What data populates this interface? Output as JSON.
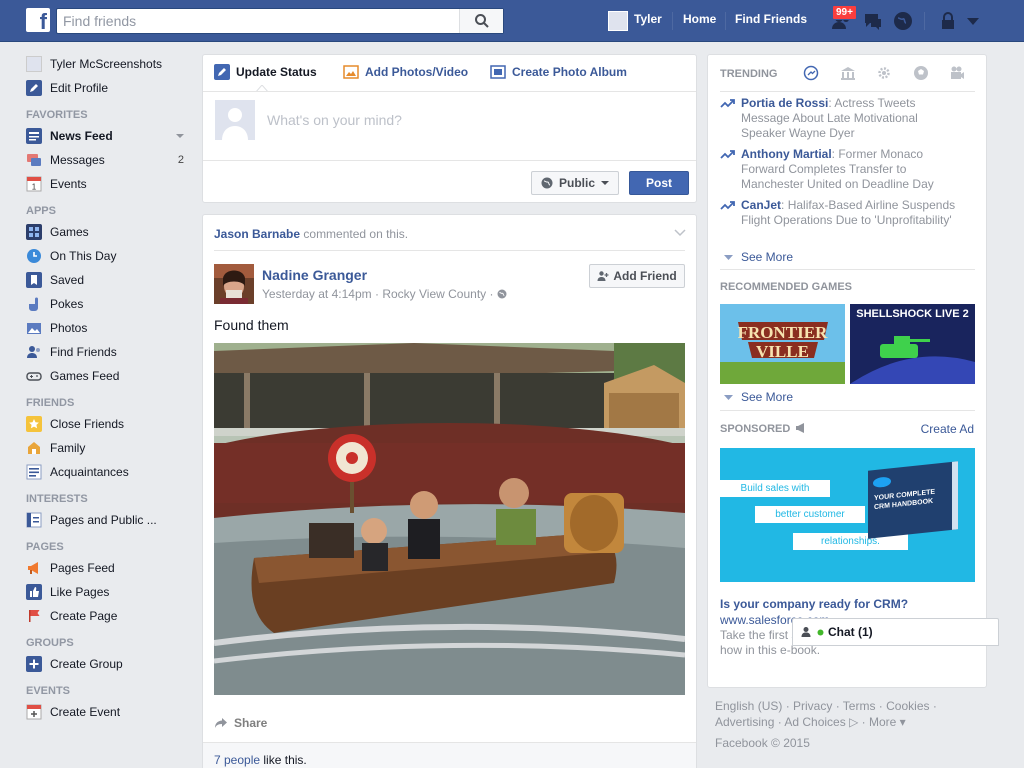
{
  "topbar": {
    "logo": "f",
    "search_placeholder": "Find friends",
    "user_name": "Tyler",
    "home": "Home",
    "find_friends": "Find Friends",
    "notif_badge": "99+",
    "icons": [
      "friend-requests-icon",
      "messages-icon",
      "notifications-globe-icon",
      "privacy-lock-icon",
      "account-menu-icon"
    ]
  },
  "leftnav": {
    "profile_name": "Tyler McScreenshots",
    "edit_profile": "Edit Profile",
    "sections": {
      "favorites": "FAVORITES",
      "apps": "APPS",
      "friends": "FRIENDS",
      "interests": "INTERESTS",
      "pages": "PAGES",
      "groups": "GROUPS",
      "events": "EVENTS"
    },
    "favorites": [
      {
        "label": "News Feed"
      },
      {
        "label": "Messages",
        "count": "2"
      },
      {
        "label": "Events"
      }
    ],
    "apps": [
      {
        "label": "Games"
      },
      {
        "label": "On This Day"
      },
      {
        "label": "Saved"
      },
      {
        "label": "Pokes"
      },
      {
        "label": "Photos"
      },
      {
        "label": "Find Friends"
      },
      {
        "label": "Games Feed"
      }
    ],
    "friends": [
      {
        "label": "Close Friends"
      },
      {
        "label": "Family"
      },
      {
        "label": "Acquaintances"
      }
    ],
    "interests": [
      {
        "label": "Pages and Public ..."
      }
    ],
    "pages": [
      {
        "label": "Pages Feed"
      },
      {
        "label": "Like Pages"
      },
      {
        "label": "Create Page"
      }
    ],
    "groups": [
      {
        "label": "Create Group"
      }
    ],
    "events": [
      {
        "label": "Create Event"
      }
    ]
  },
  "composer": {
    "tab_status": "Update Status",
    "tab_photos": "Add Photos/Video",
    "tab_album": "Create Photo Album",
    "placeholder": "What's on your mind?",
    "audience": "Public",
    "post": "Post"
  },
  "post": {
    "context_name": "Jason Barnabe",
    "context_action": "commented on this.",
    "author": "Nadine Granger",
    "time": "Yesterday at 4:14pm",
    "location": "Rocky View County",
    "add_friend": "Add Friend",
    "text": "Found them",
    "share": "Share",
    "likes_count": "7 people",
    "likes_suffix": "like this."
  },
  "trending": {
    "header": "TRENDING",
    "items": [
      {
        "name": "Portia de Rossi",
        "text": "Actress Tweets Message About Late Motivational Speaker Wayne Dyer"
      },
      {
        "name": "Anthony Martial",
        "text": "Former Monaco Forward Completes Transfer to Manchester United on Deadline Day"
      },
      {
        "name": "CanJet",
        "text": "Halifax-Based Airline Suspends Flight Operations Due to 'Unprofitability'"
      }
    ],
    "see_more": "See More"
  },
  "games": {
    "header": "RECOMMENDED GAMES",
    "tiles": [
      {
        "name": "FRONTIER VILLE"
      },
      {
        "name": "SHELLSHOCK LIVE 2"
      }
    ],
    "see_more": "See More"
  },
  "sponsored": {
    "header": "SPONSORED",
    "create_ad": "Create Ad",
    "ad_lines": [
      "Build sales with",
      "better customer",
      "relationships."
    ],
    "book_title": "YOUR COMPLETE CRM HANDBOOK",
    "title": "Is your company ready for CRM?",
    "url": "www.salesforce.com",
    "body": "Take the first step with the CRM. Find out how in this e-book."
  },
  "chat": {
    "label": "Chat (1)"
  },
  "footer": {
    "line1": "English (US) · Privacy · Terms · Cookies ·",
    "line2": "Advertising · Ad Choices ▷ · More ▾",
    "copyright": "Facebook © 2015"
  },
  "colors": {
    "brand": "#3b5998",
    "link": "#3b5998",
    "badge": "#fa3e3e",
    "post_button": "#4267b2",
    "ad_background": "#21b8e4"
  }
}
